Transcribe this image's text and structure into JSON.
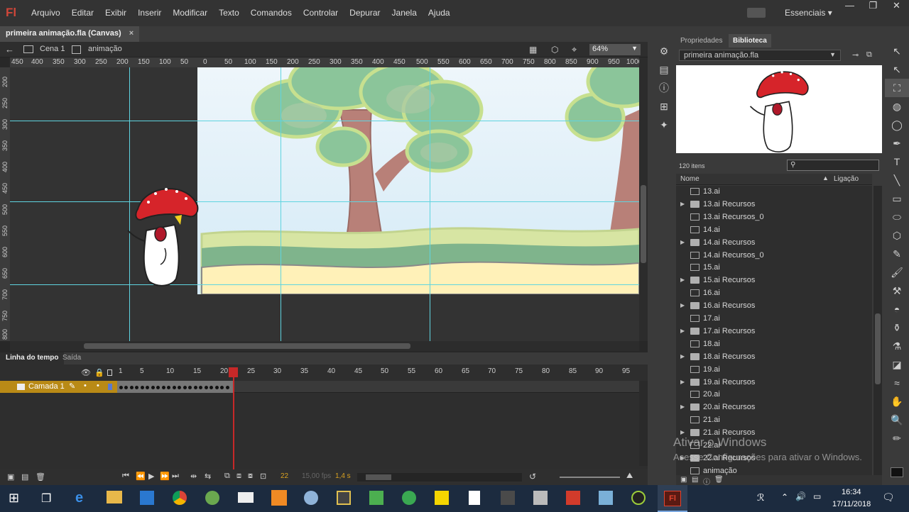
{
  "app": {
    "logo": "Fl",
    "menus": [
      "Arquivo",
      "Editar",
      "Exibir",
      "Inserir",
      "Modificar",
      "Texto",
      "Comandos",
      "Controlar",
      "Depurar",
      "Janela",
      "Ajuda"
    ],
    "workspace": "Essenciais"
  },
  "document": {
    "tab": "primeira animação.fla (Canvas)",
    "scene": "Cena 1",
    "symbol": "animação",
    "zoom": "64%"
  },
  "ruler": {
    "top_ticks": [
      "450",
      "400",
      "350",
      "300",
      "250",
      "200",
      "150",
      "100",
      "50",
      "0",
      "50",
      "100",
      "150",
      "200",
      "250",
      "300",
      "350",
      "400",
      "450",
      "500",
      "550",
      "600",
      "650",
      "700",
      "750",
      "800",
      "850",
      "900",
      "950",
      "1000"
    ],
    "left_ticks": [
      "200",
      "250",
      "300",
      "350",
      "400",
      "450",
      "500",
      "550",
      "600",
      "650",
      "700",
      "750",
      "800"
    ]
  },
  "timeline": {
    "tabs": [
      "Linha do tempo",
      "Saída"
    ],
    "frame_numbers": [
      "1",
      "5",
      "10",
      "15",
      "20",
      "25",
      "30",
      "35",
      "40",
      "45",
      "50",
      "55",
      "60",
      "65",
      "70",
      "75",
      "80",
      "85",
      "90",
      "95"
    ],
    "layer_name": "Camada 1",
    "current_frame": "22",
    "fps": "15,00 fps",
    "time": "1,4 s"
  },
  "panel": {
    "tabs": [
      "Propriedades",
      "Biblioteca"
    ],
    "doc_select": "primeira animação.fla",
    "item_count": "120 itens",
    "search_placeholder": "",
    "col_name": "Nome",
    "col_link": "Ligação",
    "items": [
      {
        "label": "13.ai",
        "type": "symbol"
      },
      {
        "label": "13.ai Recursos",
        "type": "folder"
      },
      {
        "label": "13.ai Recursos_0",
        "type": "symbol"
      },
      {
        "label": "14.ai",
        "type": "symbol"
      },
      {
        "label": "14.ai Recursos",
        "type": "folder"
      },
      {
        "label": "14.ai Recursos_0",
        "type": "symbol"
      },
      {
        "label": "15.ai",
        "type": "symbol"
      },
      {
        "label": "15.ai Recursos",
        "type": "folder"
      },
      {
        "label": "16.ai",
        "type": "symbol"
      },
      {
        "label": "16.ai Recursos",
        "type": "folder"
      },
      {
        "label": "17.ai",
        "type": "symbol"
      },
      {
        "label": "17.ai Recursos",
        "type": "folder"
      },
      {
        "label": "18.ai",
        "type": "symbol"
      },
      {
        "label": "18.ai Recursos",
        "type": "folder"
      },
      {
        "label": "19.ai",
        "type": "symbol"
      },
      {
        "label": "19.ai Recursos",
        "type": "folder"
      },
      {
        "label": "20.ai",
        "type": "symbol"
      },
      {
        "label": "20.ai Recursos",
        "type": "folder"
      },
      {
        "label": "21.ai",
        "type": "symbol"
      },
      {
        "label": "21.ai Recursos",
        "type": "folder"
      },
      {
        "label": "22.ai",
        "type": "symbol"
      },
      {
        "label": "22.ai Recursos",
        "type": "folder"
      },
      {
        "label": "animação",
        "type": "symbol"
      }
    ]
  },
  "watermark": {
    "line1": "Ativar o Windows",
    "line2": "Acesse Configurações para ativar o Windows."
  },
  "taskbar": {
    "time": "16:34",
    "date": "17/11/2018"
  }
}
